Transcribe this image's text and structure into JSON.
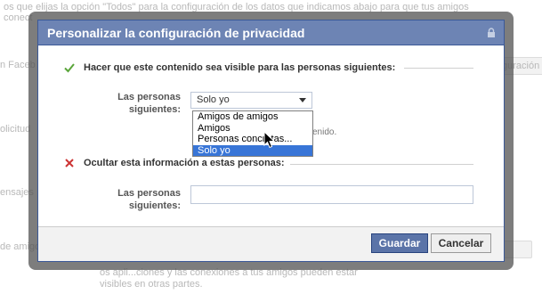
{
  "background": {
    "lines": [
      "os que elijas la opción \"Todos\" para la configuración de los datos que indicamos abajo para que tus amigos",
      "conect",
      "n Faceb",
      "olicitud",
      "ensajes",
      "de amigo",
      "os apli...ciones y las conexiones a tus amigos pueden estar",
      "visibles en otras partes."
    ],
    "right_button_fragment": "guración"
  },
  "dialog": {
    "title": "Personalizar la configuración de privacidad",
    "lock_icon": "lock-icon",
    "visible_section": {
      "icon": "check-icon",
      "heading": "Hacer que este contenido sea visible para las personas siguientes:",
      "label_line1": "Las personas",
      "label_line2": "siguientes:",
      "select_value": "Solo yo",
      "hint_fragment": "enido.",
      "dropdown_options": [
        "Amigos de amigos",
        "Amigos",
        "Personas concretas...",
        "Solo yo"
      ],
      "selected_index": 3
    },
    "hide_section": {
      "icon": "cross-icon",
      "heading": "Ocultar esta información a estas personas:",
      "label_line1": "Las personas",
      "label_line2": "siguientes:",
      "input_value": ""
    },
    "buttons": {
      "save": "Guardar",
      "cancel": "Cancelar"
    }
  },
  "colors": {
    "header_bg": "#6d84b4",
    "primary_button": "#5b74a8",
    "selected_option": "#3875d7"
  }
}
